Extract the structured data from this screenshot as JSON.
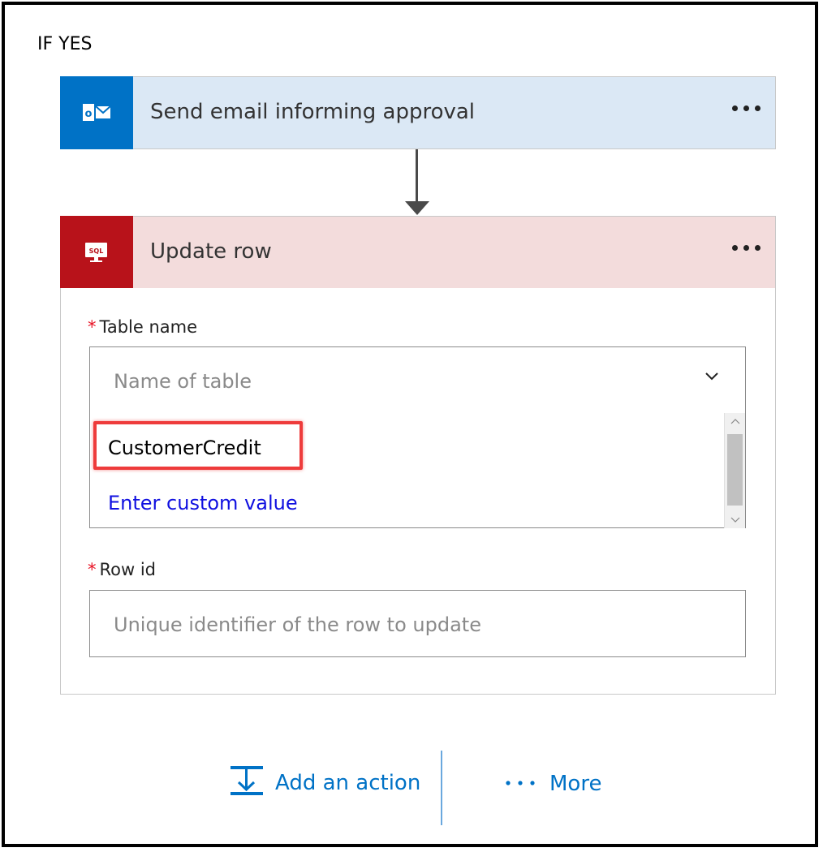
{
  "branch": {
    "title": "IF YES"
  },
  "actions": {
    "email": {
      "title": "Send email informing approval",
      "icon": "outlook-icon"
    },
    "sql": {
      "title": "Update row",
      "icon": "sql-server-icon",
      "icon_text": "SQL"
    }
  },
  "form": {
    "table_name": {
      "label": "Table name",
      "required_mark": "*",
      "placeholder": "Name of table",
      "options": [
        {
          "label": "CustomerCredit",
          "highlighted": true
        },
        {
          "label": "Enter custom value",
          "custom": true
        }
      ]
    },
    "row_id": {
      "label": "Row id",
      "required_mark": "*",
      "placeholder": "Unique identifier of the row to update"
    }
  },
  "footer": {
    "add_action_label": "Add an action",
    "more_label": "More"
  },
  "colors": {
    "outlook_blue": "#0072c6",
    "sql_red": "#b8121a",
    "outlook_header_bg": "#dbe8f5",
    "sql_header_bg": "#f3dcdc",
    "required_red": "#e81123",
    "link_blue": "#1010e0",
    "highlight_red": "#ee3b3b"
  }
}
